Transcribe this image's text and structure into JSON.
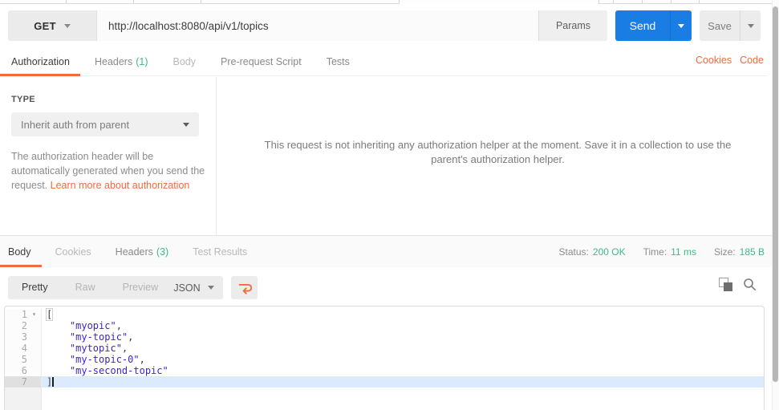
{
  "colors": {
    "accent_orange": "#f26b3a",
    "send_blue": "#1a7de3",
    "success_green": "#3cbc87",
    "json_string_purple": "#4123cd"
  },
  "request_bar": {
    "method": "GET",
    "url": "http://localhost:8080/api/v1/topics",
    "params_label": "Params",
    "send_label": "Send",
    "save_label": "Save"
  },
  "request_tabs": {
    "tabs": [
      {
        "label": "Authorization"
      },
      {
        "label": "Headers",
        "count": "(1)"
      },
      {
        "label": "Body"
      },
      {
        "label": "Pre-request Script"
      },
      {
        "label": "Tests"
      }
    ],
    "cookies_link": "Cookies",
    "code_link": "Code"
  },
  "authorization": {
    "type_label": "TYPE",
    "type_value": "Inherit auth from parent",
    "help_text": "The authorization header will be automatically generated when you send the request. ",
    "help_link": "Learn more about authorization",
    "inherit_message": "This request is not inheriting any authorization helper at the moment. Save it in a collection to use the parent's authorization helper."
  },
  "response": {
    "tabs": [
      {
        "label": "Body"
      },
      {
        "label": "Cookies"
      },
      {
        "label": "Headers",
        "count": "(3)"
      },
      {
        "label": "Test Results"
      }
    ],
    "status_label": "Status:",
    "status_value": "200 OK",
    "time_label": "Time:",
    "time_value": "11 ms",
    "size_label": "Size:",
    "size_value": "185 B",
    "view_modes": {
      "pretty": "Pretty",
      "raw": "Raw",
      "preview": "Preview"
    },
    "format": "JSON",
    "editor": {
      "lines": [
        {
          "num": "1",
          "indent": "",
          "plain": "[",
          "str": "",
          "suffix": ""
        },
        {
          "num": "2",
          "indent": "    ",
          "plain": "",
          "str": "\"myopic\"",
          "suffix": ","
        },
        {
          "num": "3",
          "indent": "    ",
          "plain": "",
          "str": "\"my-topic\"",
          "suffix": ","
        },
        {
          "num": "4",
          "indent": "    ",
          "plain": "",
          "str": "\"mytopic\"",
          "suffix": ","
        },
        {
          "num": "5",
          "indent": "    ",
          "plain": "",
          "str": "\"my-topic-0\"",
          "suffix": ","
        },
        {
          "num": "6",
          "indent": "    ",
          "plain": "",
          "str": "\"my-second-topic\"",
          "suffix": ""
        },
        {
          "num": "7",
          "indent": "",
          "plain": "]",
          "str": "",
          "suffix": ""
        }
      ]
    }
  }
}
